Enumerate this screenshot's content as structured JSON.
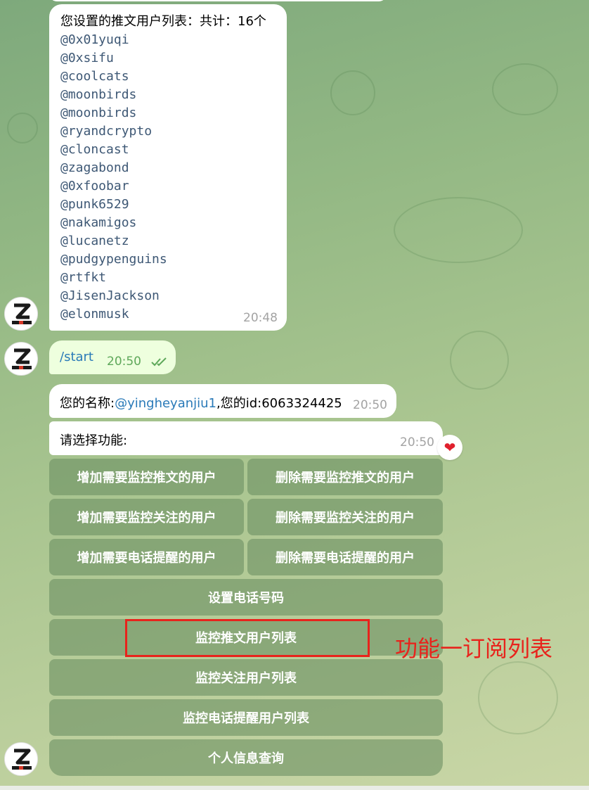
{
  "messages": {
    "list_message": {
      "header": "您设置的推文用户列表：共计：16个",
      "handles": [
        "@0x01yuqi",
        "@0xsifu",
        "@coolcats",
        "@moonbirds",
        "@moonbirds",
        "@ryandcrypto",
        "@cloncast",
        "@zagabond",
        "@0xfoobar",
        "@punk6529",
        "@nakamigos",
        "@lucanetz",
        "@pudgypenguins",
        "@rtfkt",
        "@JisenJackson",
        "@elonmusk"
      ],
      "time": "20:48"
    },
    "start_message": {
      "text": "/start",
      "time": "20:50",
      "status_icon": "double-check-icon"
    },
    "name_message": {
      "prefix": "您的名称:",
      "username": "@yingheyanjiu1",
      "suffix": ",您的id:6063324425",
      "time": "20:50"
    },
    "choose_message": {
      "text": "请选择功能:",
      "time": "20:50",
      "reaction": "heart-reaction-icon"
    }
  },
  "keyboard": {
    "rows": [
      [
        "增加需要监控推文的用户",
        "删除需要监控推文的用户"
      ],
      [
        "增加需要监控关注的用户",
        "删除需要监控关注的用户"
      ],
      [
        "增加需要电话提醒的用户",
        "删除需要电话提醒的用户"
      ],
      [
        "设置电话号码"
      ],
      [
        "监控推文用户列表"
      ],
      [
        "监控关注用户列表"
      ],
      [
        "监控电话提醒用户列表"
      ],
      [
        "个人信息查询"
      ]
    ]
  },
  "annotation": {
    "text": "功能一订阅列表",
    "color": "#e8231c"
  },
  "colors": {
    "link": "#2a7ab8",
    "outgoing_time": "#5ea85a",
    "handle_text": "#3e5875"
  }
}
